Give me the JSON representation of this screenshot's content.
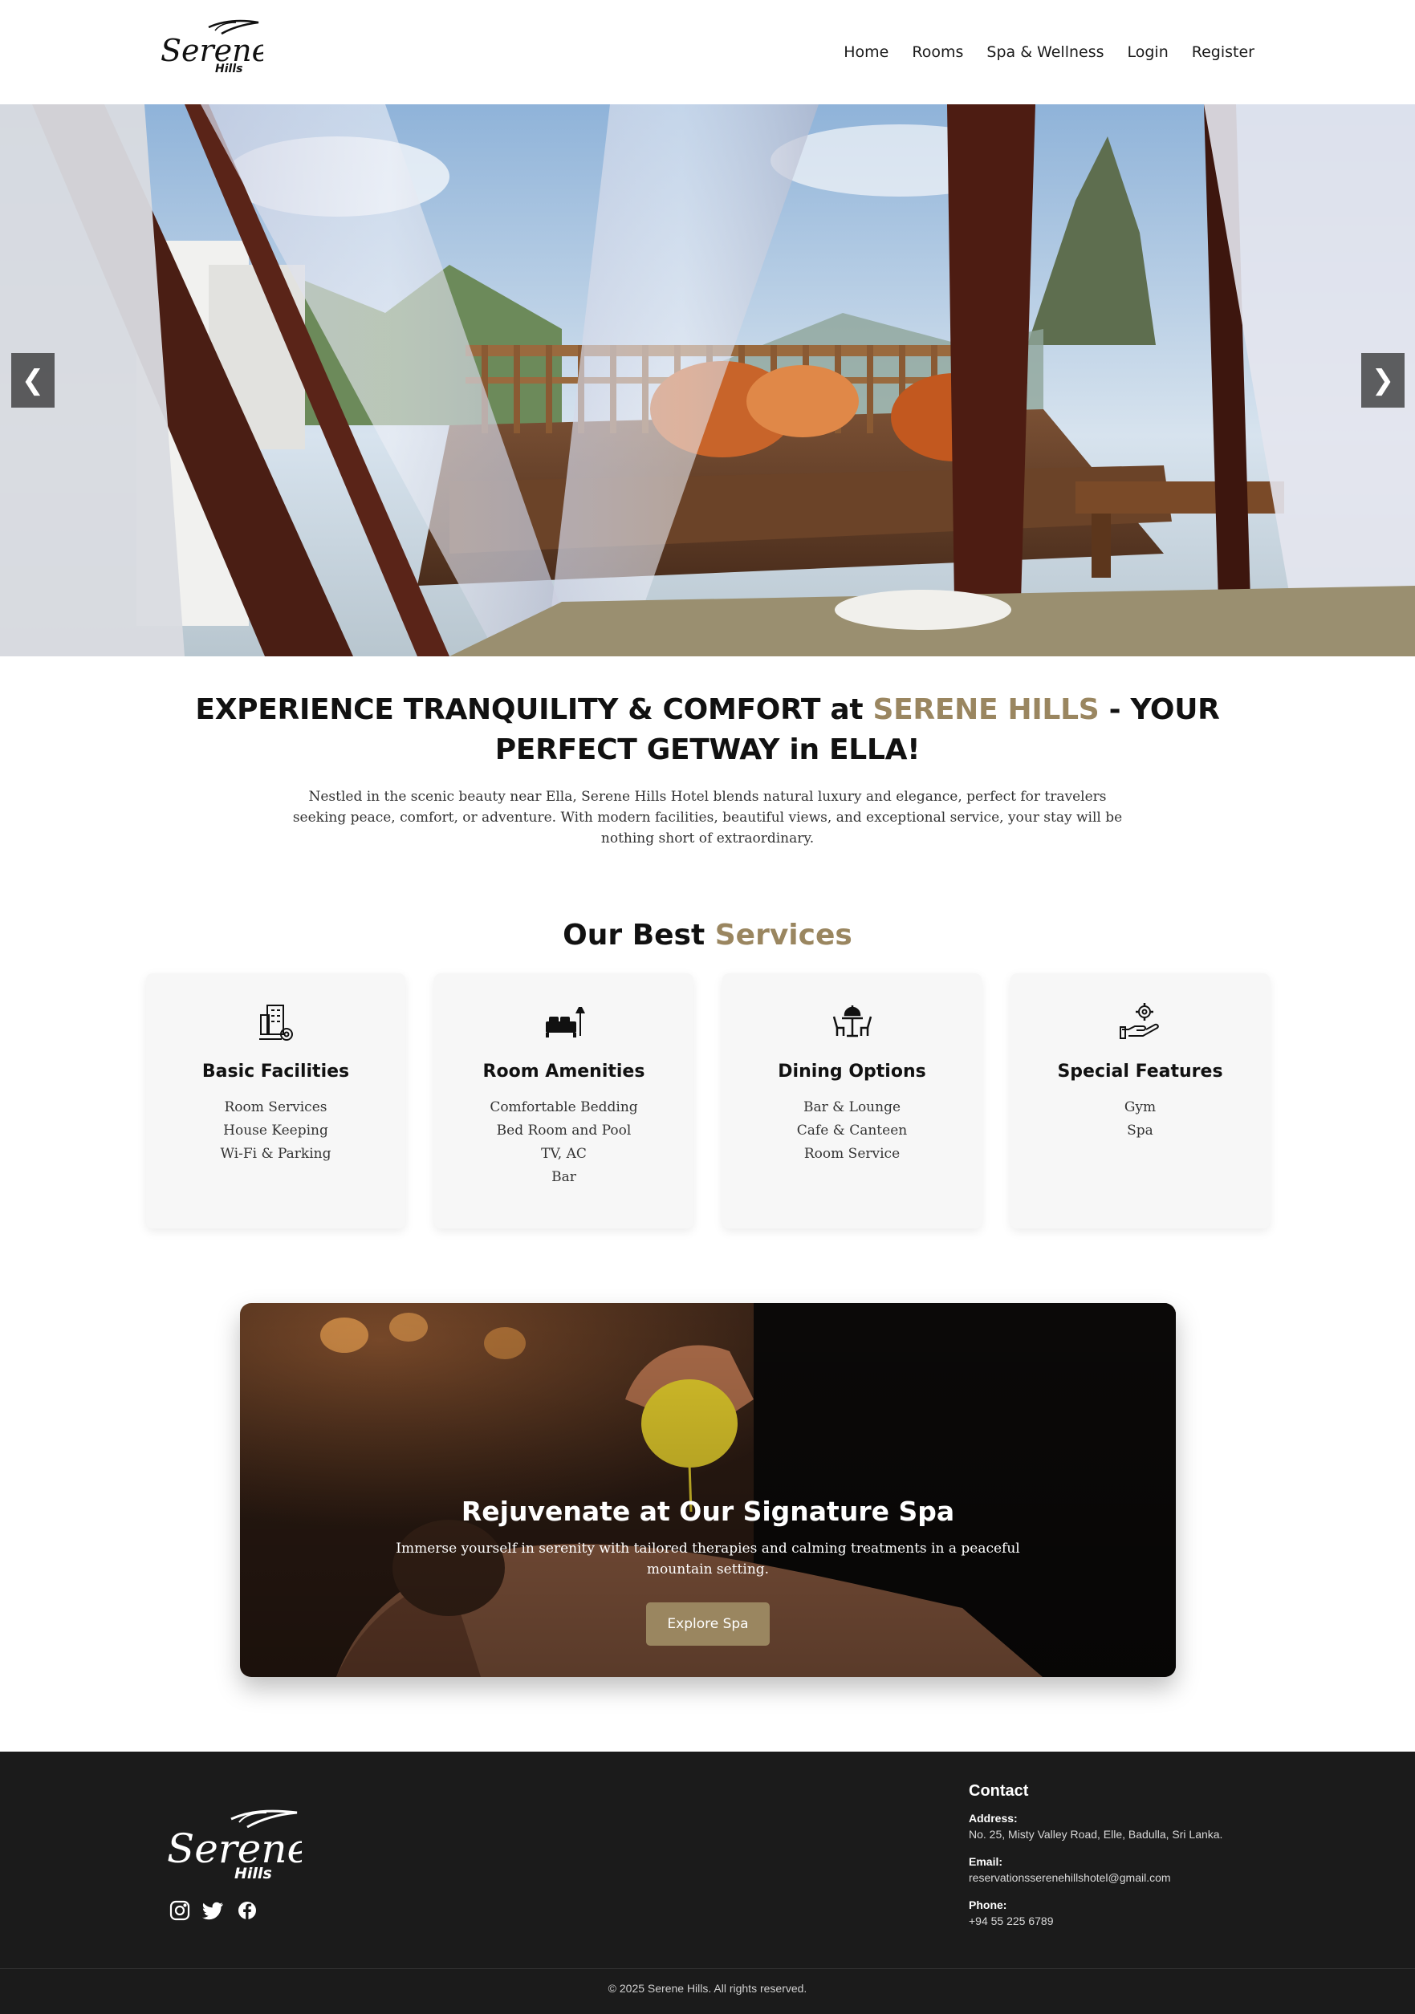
{
  "header": {
    "logo_text": "Serene",
    "logo_subtext": "Hills",
    "nav": [
      "Home",
      "Rooms",
      "Spa & Wellness",
      "Login",
      "Register"
    ]
  },
  "hero": {
    "prev_arrow": "❮",
    "next_arrow": "❯"
  },
  "intro": {
    "title_part1": "EXPERIENCE TRANQUILITY & COMFORT at ",
    "title_highlight": "SERENE HILLS",
    "title_part2": " - YOUR PERFECT GETWAY in ELLA!",
    "description": "Nestled in the scenic beauty near Ella, Serene Hills Hotel blends natural luxury and elegance, perfect for travelers seeking peace, comfort, or adventure. With modern facilities, beautiful views, and exceptional service, your stay will be nothing short of extraordinary."
  },
  "services": {
    "title_part1": "Our Best ",
    "title_highlight": "Services",
    "cards": [
      {
        "title": "Basic Facilities",
        "icon": "building-gear-icon",
        "items": [
          "Room Services",
          "House Keeping",
          "Wi-Fi & Parking"
        ]
      },
      {
        "title": "Room Amenities",
        "icon": "bed-lamp-icon",
        "items": [
          "Comfortable Bedding",
          "Bed Room and Pool",
          "TV, AC",
          "Bar"
        ]
      },
      {
        "title": "Dining Options",
        "icon": "dining-table-icon",
        "items": [
          "Bar & Lounge",
          "Cafe & Canteen",
          "Room Service"
        ]
      },
      {
        "title": "Special Features",
        "icon": "hand-gear-icon",
        "items": [
          "Gym",
          "Spa"
        ]
      }
    ]
  },
  "spa": {
    "title": "Rejuvenate at Our Signature Spa",
    "description": "Immerse yourself in serenity with tailored therapies and calming treatments in a peaceful mountain setting.",
    "button": "Explore Spa"
  },
  "footer": {
    "logo_text": "Serene",
    "logo_subtext": "Hills",
    "social_icons": [
      "instagram-icon",
      "twitter-icon",
      "facebook-icon"
    ],
    "contact_title": "Contact",
    "address_label": "Address:",
    "address": "No. 25, Misty Valley Road, Elle, Badulla, Sri Lanka.",
    "email_label": "Email:",
    "email": "reservationsserenehillshotel@gmail.com",
    "phone_label": "Phone:",
    "phone": "+94 55 225 6789",
    "copyright": "© 2025 Serene Hills. All rights reserved."
  },
  "colors": {
    "accent": "#9a8660",
    "footer_bg": "#1b1b1b"
  }
}
